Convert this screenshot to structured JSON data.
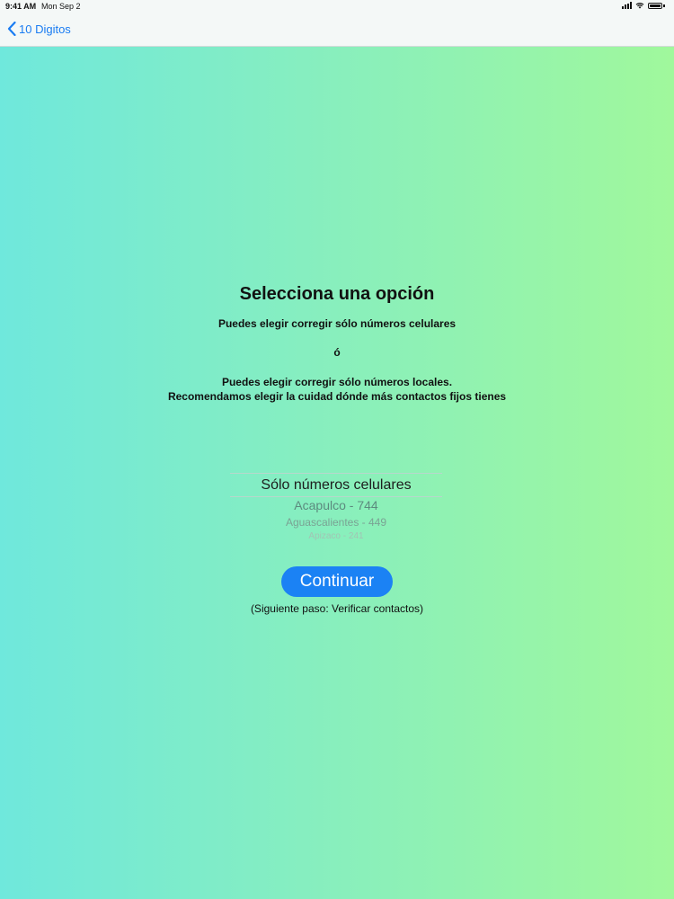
{
  "status_bar": {
    "time": "9:41 AM",
    "date": "Mon Sep 2"
  },
  "nav": {
    "back_label": "10 Digitos"
  },
  "main": {
    "title": "Selecciona una opción",
    "line1": "Puedes elegir corregir sólo números celulares",
    "separator": "ó",
    "line2": "Puedes elegir corregir sólo números locales.",
    "line3": "Recomendamos elegir la cuidad dónde más contactos fijos tienes"
  },
  "picker": {
    "selected": "Sólo números celulares",
    "options": [
      "Acapulco - 744",
      "Aguascalientes - 449",
      "Apizaco - 241"
    ]
  },
  "actions": {
    "continue_label": "Continuar",
    "next_step": "(Siguiente paso: Verificar contactos)"
  },
  "colors": {
    "accent": "#1b82f4",
    "gradient_left": "#6fe8dc",
    "gradient_right": "#a0f89c"
  }
}
